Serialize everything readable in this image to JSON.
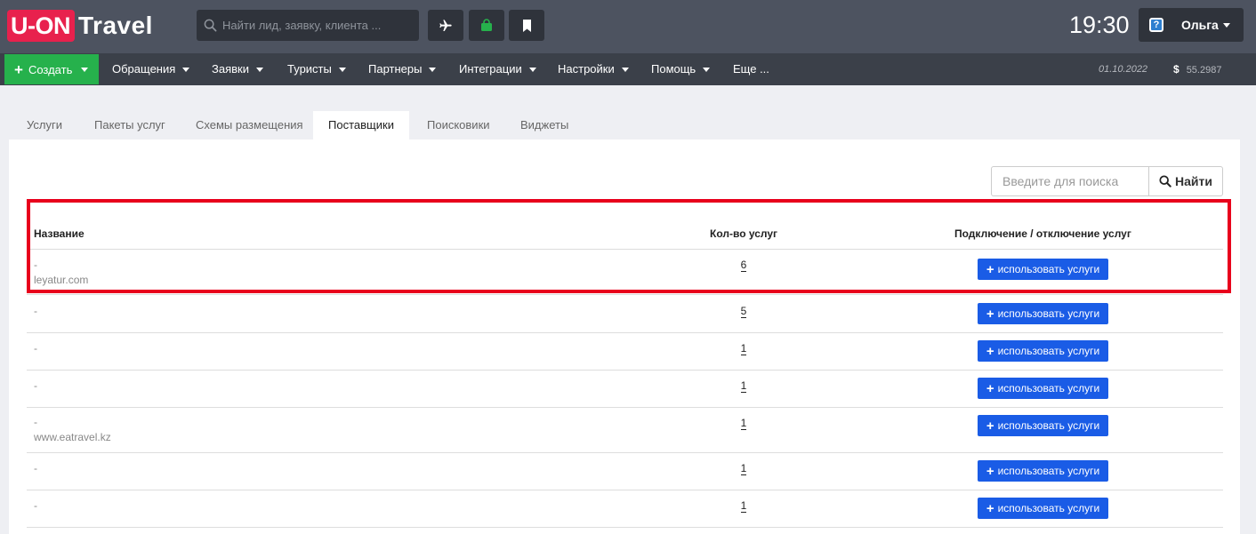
{
  "header": {
    "logo_box": "U-ON",
    "logo_text": "Travel",
    "search_placeholder": "Найти лид, заявку, клиента ...",
    "time": "19:30",
    "user_name": "Ольга"
  },
  "nav": {
    "create_label": "Создать",
    "items": [
      "Обращения",
      "Заявки",
      "Туристы",
      "Партнеры",
      "Интеграции",
      "Настройки",
      "Помощь",
      "Еще ..."
    ],
    "date": "01.10.2022",
    "currency_symbol": "$",
    "currency_rate": "55.2987"
  },
  "tabs": [
    "Услуги",
    "Пакеты услуг",
    "Схемы размещения",
    "Поставщики",
    "Поисковики",
    "Виджеты"
  ],
  "active_tab": "Поставщики",
  "panel": {
    "search_placeholder": "Введите для поиска",
    "find_label": "Найти",
    "columns": [
      "Название",
      "Кол-во услуг",
      "Подключение / отключение услуг"
    ],
    "button_label": "использовать услуги",
    "rows": [
      {
        "name": "-",
        "site": "leyatur.com",
        "count": "6"
      },
      {
        "name": "-",
        "site": "",
        "count": "5"
      },
      {
        "name": "-",
        "site": "",
        "count": "1"
      },
      {
        "name": "-",
        "site": "",
        "count": "1"
      },
      {
        "name": "-",
        "site": "www.eatravel.kz",
        "count": "1"
      },
      {
        "name": "-",
        "site": "",
        "count": "1"
      },
      {
        "name": "-",
        "site": "",
        "count": "1"
      }
    ]
  },
  "colors": {
    "logo_red": "#e8214d",
    "create_green": "#26b14c",
    "button_blue": "#1a5ce6",
    "highlight_red": "#e8001c"
  }
}
